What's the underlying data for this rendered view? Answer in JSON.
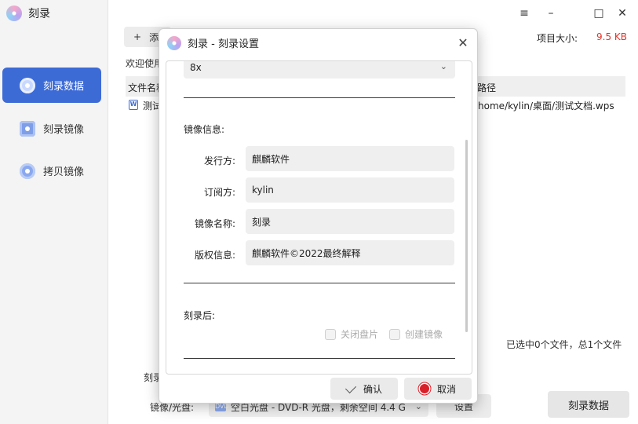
{
  "app": {
    "title": "刻录"
  },
  "window_controls": {
    "menu": "≡",
    "minimize": "–",
    "maximize": "□",
    "close": "✕"
  },
  "sidebar": {
    "items": [
      {
        "label": "刻录数据",
        "icon": "disc-icon",
        "active": true
      },
      {
        "label": "刻录镜像",
        "icon": "disc-image-icon",
        "active": false
      },
      {
        "label": "拷贝镜像",
        "icon": "disc-copy-icon",
        "active": false
      }
    ]
  },
  "header": {
    "size_label": "项目大小:",
    "size_value": "9.5 KB",
    "add_label": "添"
  },
  "main": {
    "welcome": "欢迎使用",
    "columns": {
      "name": "文件名称",
      "path": "路径"
    },
    "rows": [
      {
        "name": "测试",
        "path": "/home/kylin/桌面/测试文档.wps"
      }
    ],
    "status": "已选中0个文件，总1个文件"
  },
  "bottom": {
    "label1": "刻录",
    "label2": "镜像/光盘:",
    "media_value": "空白光盘 - DVD-R 光盘，剩余空间 4.4 G",
    "media_icon": "DVD",
    "settings_label": "设置",
    "burn_label": "刻录数据"
  },
  "dialog": {
    "title": "刻录 - 刻录设置",
    "speed_value": "8x",
    "image_info_label": "镜像信息:",
    "fields": [
      {
        "label": "发行方:",
        "value": "麒麟软件"
      },
      {
        "label": "订阅方:",
        "value": "kylin"
      },
      {
        "label": "镜像名称:",
        "value": "刻录"
      },
      {
        "label": "版权信息:",
        "value": "麒麟软件©2022最终解释"
      }
    ],
    "after_burn_label": "刻录后:",
    "options": [
      {
        "label": "关闭盘片",
        "checked": false
      },
      {
        "label": "创建镜像",
        "checked": false
      }
    ],
    "ok_label": "确认",
    "cancel_label": "取消"
  }
}
